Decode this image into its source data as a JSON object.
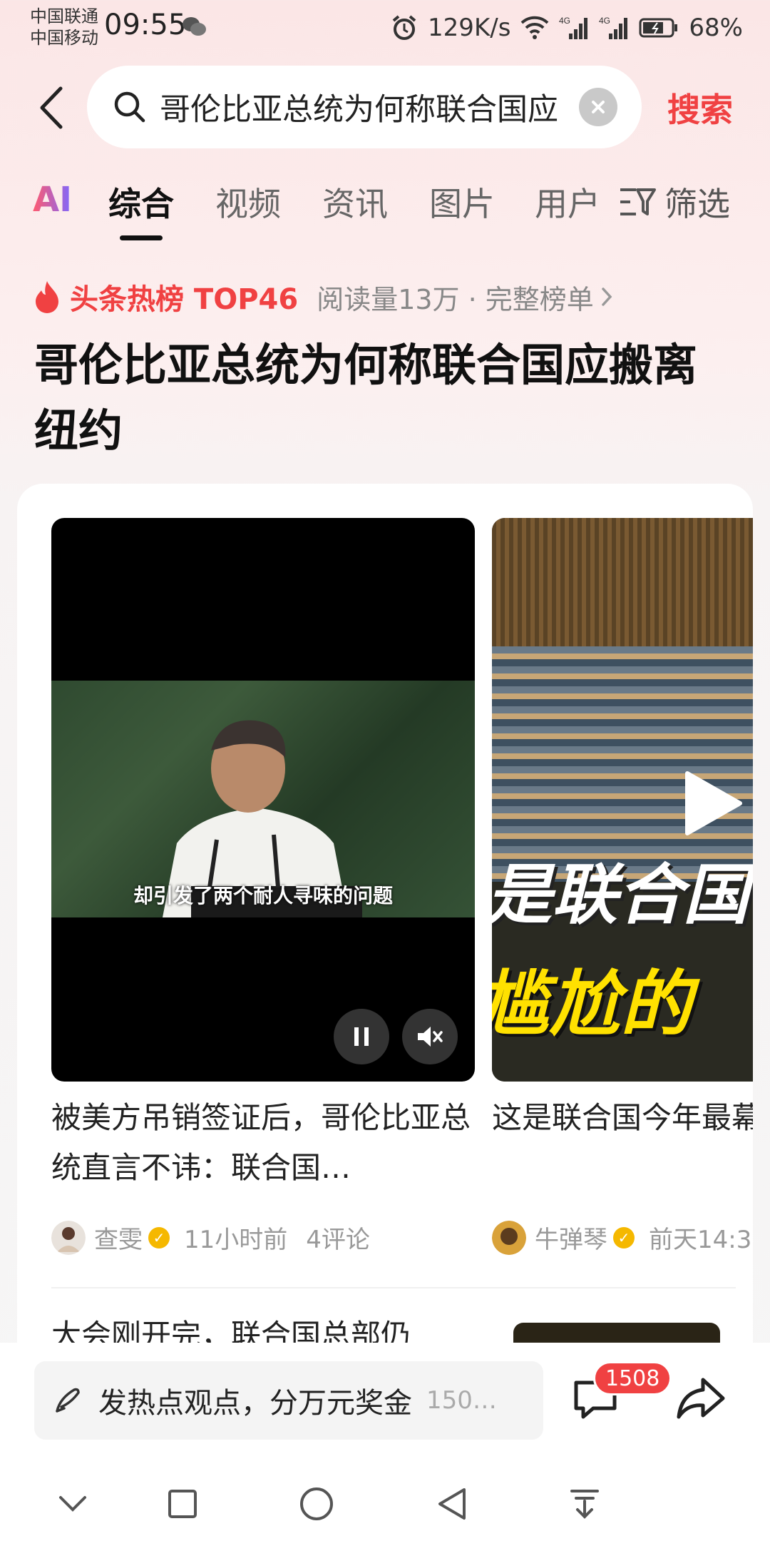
{
  "status_bar": {
    "carrier_1": "中国联通",
    "carrier_2": "中国移动",
    "time": "09:55",
    "net_speed": "129K/s",
    "signal_1": "4G",
    "signal_2": "4G",
    "battery": "68%"
  },
  "search": {
    "query": "哥伦比亚总统为何称联合国应",
    "submit_label": "搜索"
  },
  "tabs": {
    "ai": "AI",
    "items": [
      "综合",
      "视频",
      "资讯",
      "图片",
      "用户"
    ],
    "active": "综合",
    "filter": "筛选"
  },
  "hot": {
    "label": "头条热榜 TOP46",
    "reads": "阅读量13万 · 完整榜单",
    "topic_title": "哥伦比亚总统为何称联合国应搬离纽约"
  },
  "videos": [
    {
      "subtitle": "却引发了两个耐人寻味的问题",
      "title": "被美方吊销签证后，哥伦比亚总统直言不讳：联合国…",
      "author": "查雯",
      "time": "11小时前",
      "comments": "4评论"
    },
    {
      "overlay_line_1": "是联合国",
      "overlay_line_2": "尴尬的",
      "title": "这是联合国今年最幕",
      "author": "牛弹琴",
      "time": "前天14:3"
    }
  ],
  "next_item": {
    "title": "大会刚开完，联合国总部仍"
  },
  "bottom_bar": {
    "comment_prompt": "发热点观点，分万元奖金",
    "comment_hint": "150…",
    "comment_badge": "1508"
  }
}
